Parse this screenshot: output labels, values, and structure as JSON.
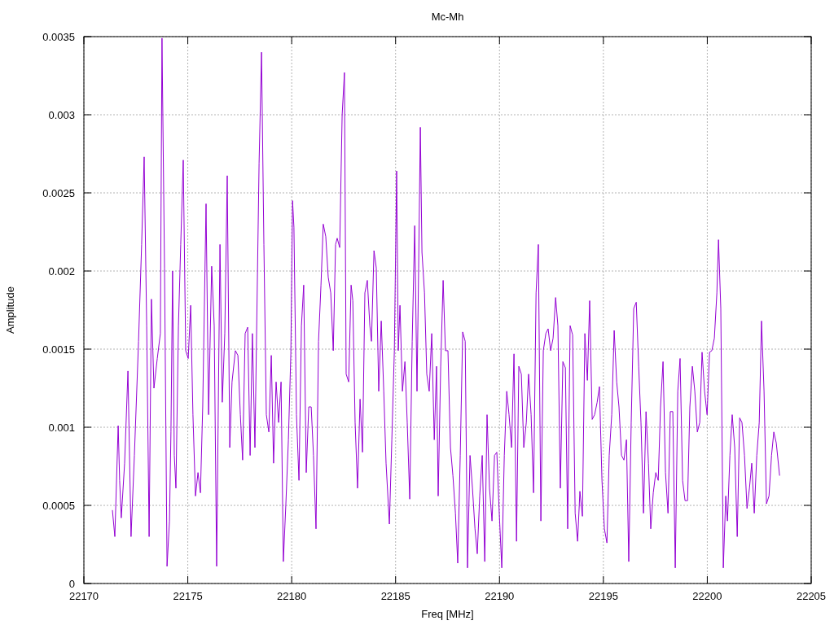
{
  "chart_data": {
    "type": "line",
    "grid": true,
    "title": "Mc-Mh",
    "xlabel": "Freq [MHz]",
    "ylabel": "Amplitude",
    "xlim": [
      22170,
      22205
    ],
    "ylim": [
      0,
      0.0035
    ],
    "xticks": [
      22170,
      22175,
      22180,
      22185,
      22190,
      22195,
      22200,
      22205
    ],
    "yticks": [
      0,
      0.0005,
      0.001,
      0.0015,
      0.002,
      0.0025,
      0.003,
      0.0035
    ],
    "x": [
      22171.37,
      22171.49,
      22171.65,
      22171.72,
      22171.8,
      22171.96,
      22172.12,
      22172.27,
      22172.43,
      22172.63,
      22172.78,
      22172.9,
      22173.02,
      22173.14,
      22173.25,
      22173.37,
      22173.53,
      22173.68,
      22173.76,
      22173.88,
      22174.0,
      22174.12,
      22174.19,
      22174.27,
      22174.35,
      22174.43,
      22174.55,
      22174.66,
      22174.78,
      22174.9,
      22175.02,
      22175.14,
      22175.25,
      22175.37,
      22175.49,
      22175.61,
      22175.72,
      22175.88,
      22176.0,
      22176.15,
      22176.27,
      22176.39,
      22176.55,
      22176.66,
      22176.78,
      22176.9,
      22177.02,
      22177.13,
      22177.29,
      22177.41,
      22177.53,
      22177.64,
      22177.76,
      22177.88,
      22178.0,
      22178.11,
      22178.23,
      22178.43,
      22178.55,
      22178.66,
      22178.78,
      22178.9,
      22179.02,
      22179.13,
      22179.25,
      22179.37,
      22179.49,
      22179.6,
      22179.72,
      22179.84,
      22179.96,
      22180.04,
      22180.11,
      22180.23,
      22180.35,
      22180.47,
      22180.58,
      22180.7,
      22180.82,
      22180.94,
      22181.05,
      22181.17,
      22181.29,
      22181.41,
      22181.52,
      22181.64,
      22181.76,
      22181.88,
      22182.0,
      22182.11,
      22182.19,
      22182.31,
      22182.43,
      22182.54,
      22182.62,
      22182.74,
      22182.86,
      22182.94,
      22183.05,
      22183.17,
      22183.29,
      22183.41,
      22183.52,
      22183.64,
      22183.76,
      22183.84,
      22183.96,
      22184.07,
      22184.19,
      22184.31,
      22184.43,
      22184.54,
      22184.7,
      22184.82,
      22184.94,
      22185.05,
      22185.13,
      22185.21,
      22185.33,
      22185.45,
      22185.56,
      22185.68,
      22185.8,
      22185.92,
      22186.03,
      22186.11,
      22186.19,
      22186.27,
      22186.39,
      22186.5,
      22186.62,
      22186.74,
      22186.86,
      22186.97,
      22187.05,
      22187.17,
      22187.29,
      22187.4,
      22187.52,
      22187.64,
      22187.76,
      22187.88,
      22187.99,
      22188.11,
      22188.23,
      22188.35,
      22188.46,
      22188.58,
      22188.7,
      22188.82,
      22188.93,
      22189.05,
      22189.17,
      22189.29,
      22189.4,
      22189.52,
      22189.64,
      22189.76,
      22189.87,
      22189.99,
      22190.11,
      22190.23,
      22190.35,
      22190.46,
      22190.58,
      22190.7,
      22190.82,
      22190.93,
      22191.05,
      22191.17,
      22191.29,
      22191.4,
      22191.52,
      22191.64,
      22191.76,
      22191.87,
      22191.99,
      22192.11,
      22192.23,
      22192.34,
      22192.46,
      22192.58,
      22192.7,
      22192.81,
      22192.93,
      22193.05,
      22193.17,
      22193.28,
      22193.4,
      22193.52,
      22193.64,
      22193.76,
      22193.87,
      22193.99,
      22194.11,
      22194.23,
      22194.34,
      22194.46,
      22194.58,
      22194.7,
      22194.81,
      22194.93,
      22195.05,
      22195.17,
      22195.28,
      22195.4,
      22195.52,
      22195.64,
      22195.75,
      22195.87,
      22195.99,
      22196.11,
      22196.22,
      22196.34,
      22196.46,
      22196.58,
      22196.7,
      22196.81,
      22196.93,
      22197.05,
      22197.17,
      22197.28,
      22197.4,
      22197.52,
      22197.64,
      22197.75,
      22197.87,
      22197.99,
      22198.11,
      22198.22,
      22198.34,
      22198.46,
      22198.58,
      22198.69,
      22198.81,
      22198.93,
      22199.05,
      22199.16,
      22199.28,
      22199.4,
      22199.52,
      22199.64,
      22199.75,
      22199.87,
      22199.99,
      22200.11,
      22200.22,
      22200.34,
      22200.46,
      22200.54,
      22200.65,
      22200.77,
      22200.89,
      22200.97,
      22201.09,
      22201.2,
      22201.32,
      22201.44,
      22201.56,
      22201.67,
      22201.79,
      22201.91,
      22202.03,
      22202.14,
      22202.26,
      22202.38,
      22202.5,
      22202.61,
      22202.73,
      22202.85,
      22202.97,
      22203.09,
      22203.2,
      22203.32,
      22203.48
    ],
    "series": [
      {
        "color": "#9400d3",
        "values": [
          0.00047,
          0.0003,
          0.00101,
          0.00066,
          0.00042,
          0.00077,
          0.00136,
          0.0003,
          0.00082,
          0.00155,
          0.00217,
          0.00273,
          0.00165,
          0.0003,
          0.00182,
          0.00125,
          0.00144,
          0.0016,
          0.00349,
          0.00202,
          0.00011,
          0.0004,
          0.00097,
          0.002,
          0.00082,
          0.00061,
          0.00165,
          0.00217,
          0.00271,
          0.00149,
          0.00144,
          0.00178,
          0.00108,
          0.00056,
          0.00071,
          0.00058,
          0.00113,
          0.00243,
          0.00108,
          0.00203,
          0.00165,
          0.00011,
          0.00217,
          0.00116,
          0.0016,
          0.00261,
          0.00087,
          0.00129,
          0.00149,
          0.00146,
          0.00108,
          0.00079,
          0.0016,
          0.00164,
          0.00082,
          0.0016,
          0.00087,
          0.00269,
          0.0034,
          0.00217,
          0.00108,
          0.00097,
          0.00146,
          0.00077,
          0.00129,
          0.00103,
          0.00129,
          0.00014,
          0.00051,
          0.00092,
          0.00147,
          0.00245,
          0.00228,
          0.00108,
          0.00066,
          0.00165,
          0.00191,
          0.00071,
          0.00113,
          0.00113,
          0.00082,
          0.00035,
          0.00155,
          0.00191,
          0.0023,
          0.00222,
          0.00196,
          0.00186,
          0.00149,
          0.00217,
          0.00221,
          0.00215,
          0.003,
          0.00327,
          0.00134,
          0.00129,
          0.00191,
          0.00181,
          0.00103,
          0.00061,
          0.00118,
          0.00084,
          0.00186,
          0.00194,
          0.00165,
          0.00155,
          0.00213,
          0.00202,
          0.00123,
          0.00168,
          0.00123,
          0.00077,
          0.00038,
          0.00092,
          0.00149,
          0.00264,
          0.00149,
          0.00178,
          0.00123,
          0.00142,
          0.00103,
          0.00054,
          0.00155,
          0.00229,
          0.00123,
          0.00202,
          0.00292,
          0.00212,
          0.00186,
          0.00134,
          0.00123,
          0.0016,
          0.00092,
          0.00139,
          0.00056,
          0.00139,
          0.00194,
          0.00149,
          0.00149,
          0.00087,
          0.00069,
          0.00045,
          0.00013,
          0.00082,
          0.00161,
          0.00155,
          0.0001,
          0.00082,
          0.00061,
          0.00035,
          0.00019,
          0.00056,
          0.00082,
          0.00014,
          0.00108,
          0.00061,
          0.0004,
          0.00082,
          0.00084,
          0.00045,
          0.0001,
          0.00082,
          0.00123,
          0.00108,
          0.00087,
          0.00147,
          0.00027,
          0.00139,
          0.00134,
          0.00087,
          0.00103,
          0.00134,
          0.00108,
          0.00058,
          0.00186,
          0.00217,
          0.0004,
          0.00149,
          0.0016,
          0.00163,
          0.00149,
          0.00157,
          0.00183,
          0.00165,
          0.00061,
          0.00142,
          0.00138,
          0.00035,
          0.00165,
          0.00159,
          0.00045,
          0.00027,
          0.00059,
          0.00043,
          0.0016,
          0.0013,
          0.00181,
          0.00105,
          0.00108,
          0.00116,
          0.00126,
          0.00066,
          0.00035,
          0.00026,
          0.00082,
          0.00108,
          0.00162,
          0.00129,
          0.00113,
          0.00082,
          0.00079,
          0.00092,
          0.00014,
          0.00103,
          0.00176,
          0.0018,
          0.00139,
          0.00103,
          0.00045,
          0.0011,
          0.00077,
          0.00035,
          0.00058,
          0.00071,
          0.00066,
          0.00113,
          0.00142,
          0.00071,
          0.00045,
          0.0011,
          0.0011,
          0.0001,
          0.00123,
          0.00144,
          0.00066,
          0.00053,
          0.00053,
          0.00113,
          0.00139,
          0.00123,
          0.00097,
          0.00103,
          0.00148,
          0.00123,
          0.00108,
          0.00148,
          0.00149,
          0.00157,
          0.00186,
          0.0022,
          0.00176,
          0.0001,
          0.00056,
          0.0004,
          0.00082,
          0.00108,
          0.00087,
          0.0003,
          0.00106,
          0.00103,
          0.00082,
          0.00048,
          0.00061,
          0.00077,
          0.00045,
          0.00082,
          0.00103,
          0.00168,
          0.00123,
          0.00051,
          0.00056,
          0.00082,
          0.00097,
          0.0009,
          0.00069
        ]
      }
    ]
  }
}
